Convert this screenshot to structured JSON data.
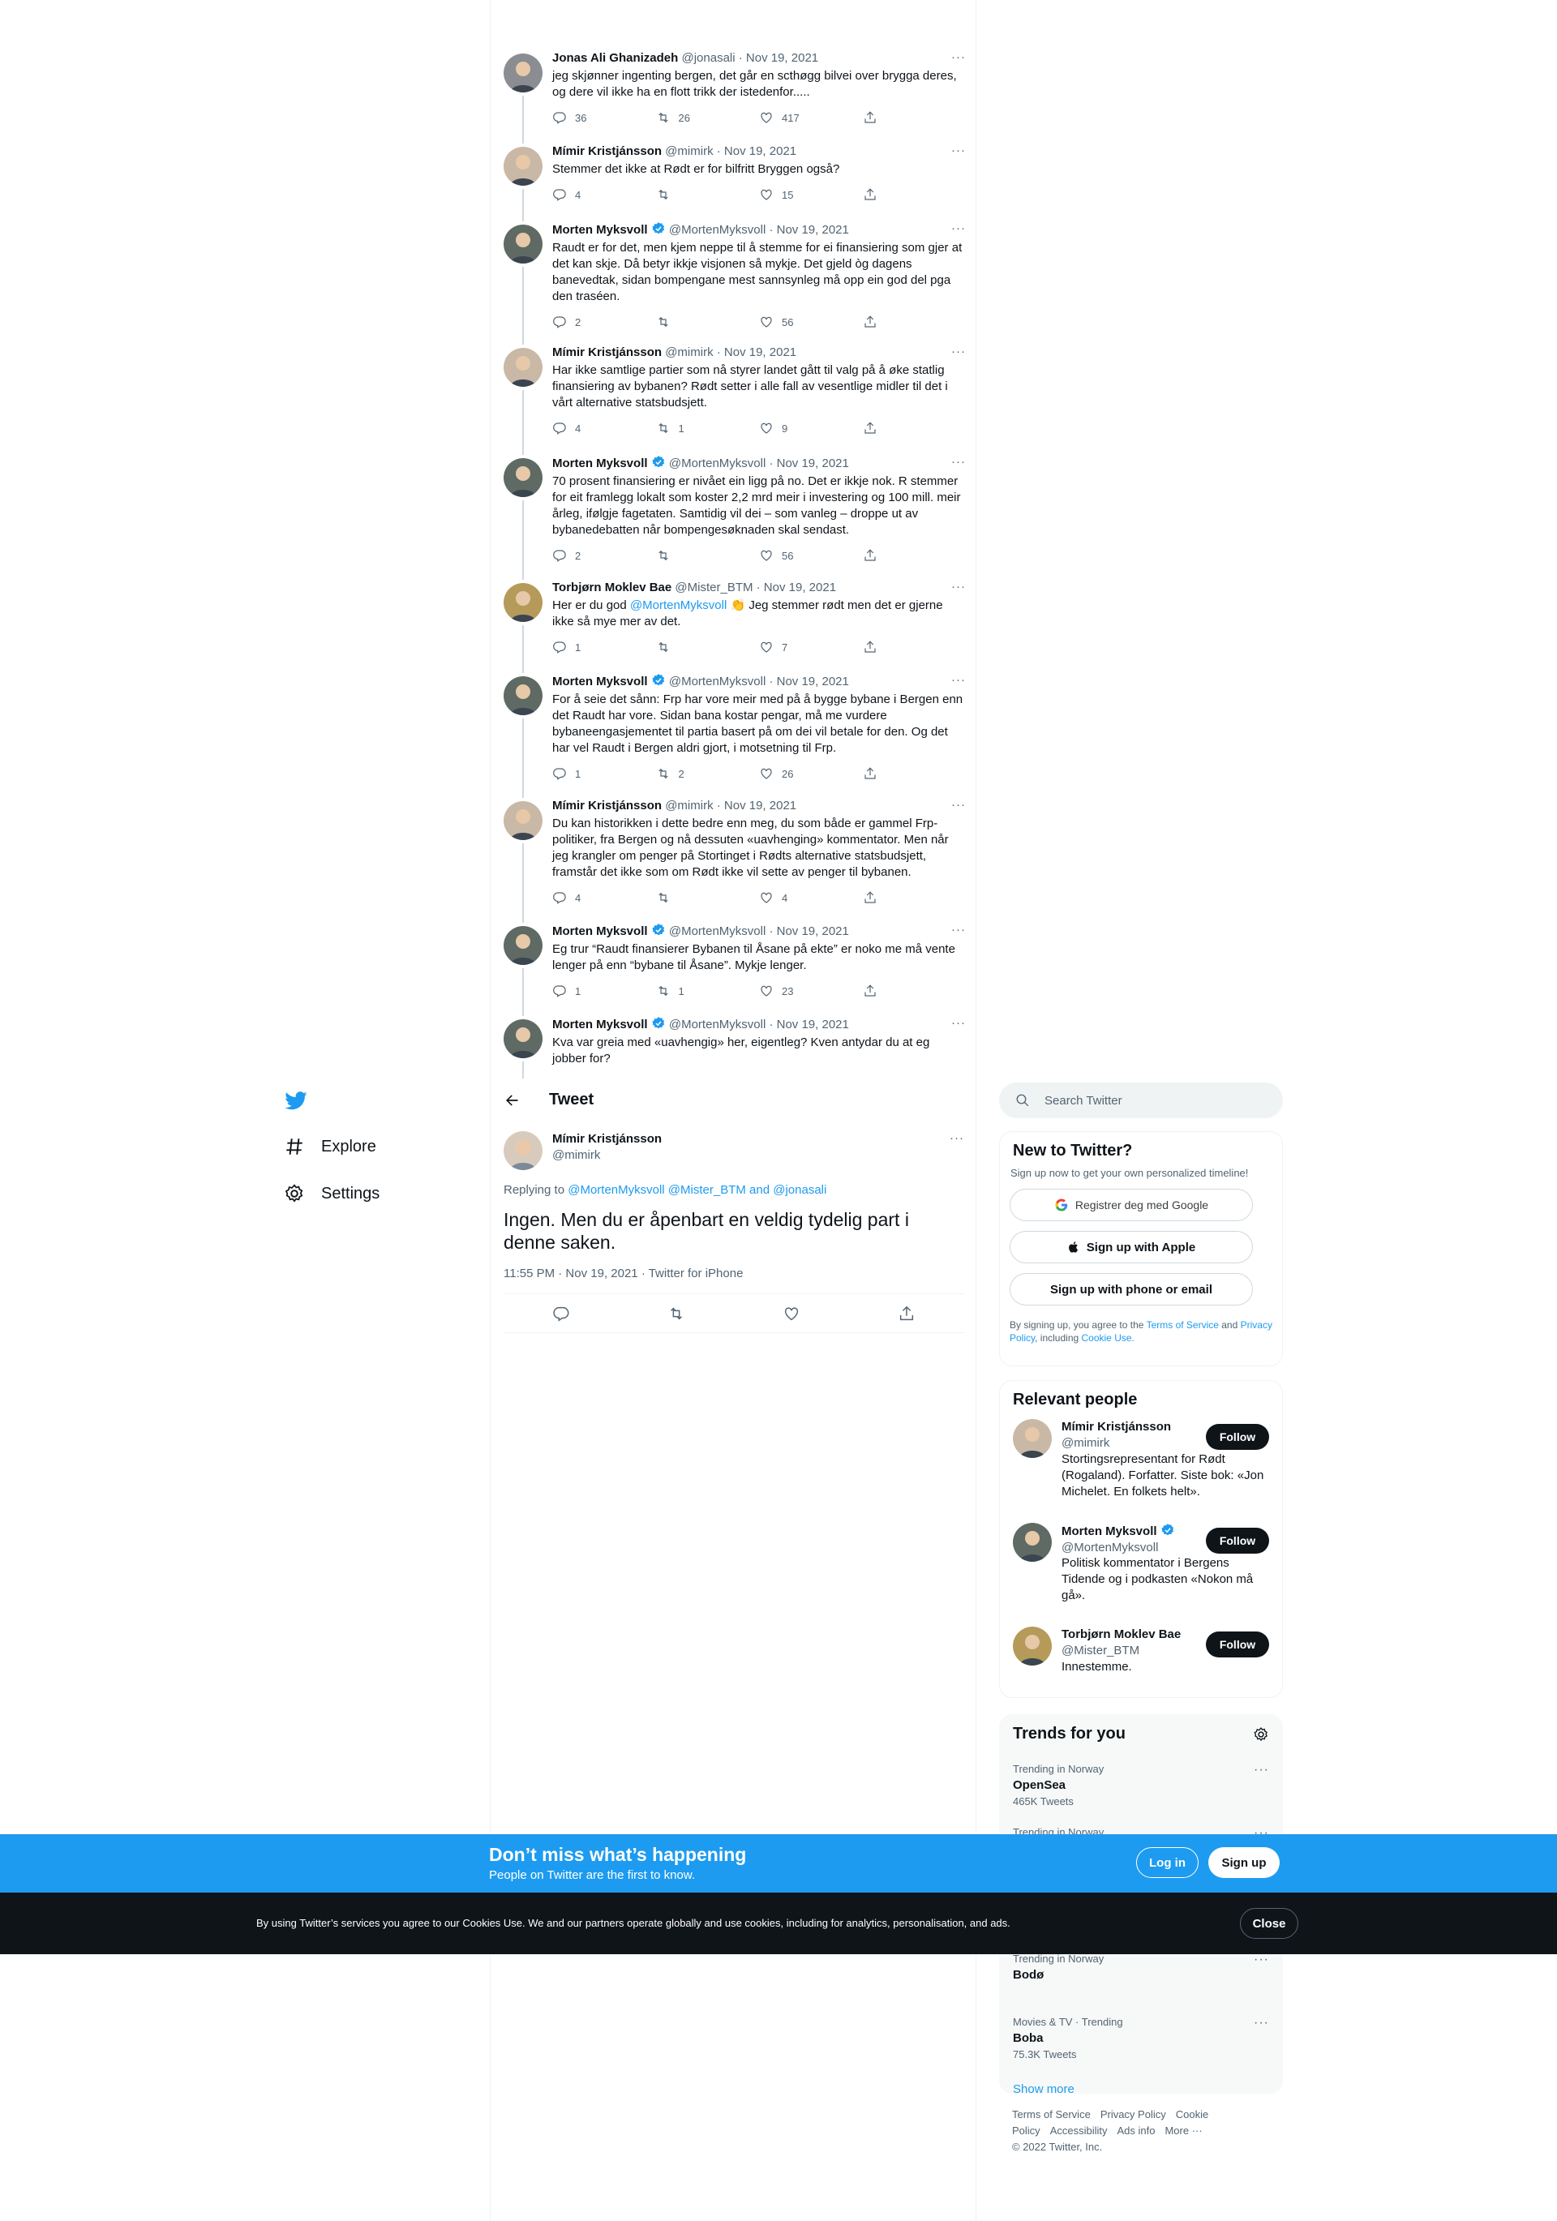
{
  "thread": [
    {
      "name": "Jonas Ali Ghanizadeh",
      "handle": "@jonasali",
      "date": "Nov 19, 2021",
      "verified": false,
      "text": "jeg skjønner ingenting bergen, det går en scthøgg bilvei over brygga deres, og dere vil ikke ha en flott trikk der istedenfor.....",
      "replies": "36",
      "retweets": "26",
      "likes": "417",
      "avatar": "#8a8d92"
    },
    {
      "name": "Mímir Kristjánsson",
      "handle": "@mimirk",
      "date": "Nov 19, 2021",
      "verified": false,
      "text": "Stemmer det ikke at Rødt er for bilfritt Bryggen også?",
      "replies": "4",
      "retweets": "",
      "likes": "15",
      "avatar": "#c9b8a6"
    },
    {
      "name": "Morten Myksvoll",
      "handle": "@MortenMyksvoll",
      "date": "Nov 19, 2021",
      "verified": true,
      "text": "Raudt er for det, men kjem neppe til å stemme for ei finansiering som gjer at det kan skje. Då betyr ikkje visjonen så mykje. Det gjeld òg dagens banevedtak, sidan bompengane mest sannsynleg må opp ein god del pga den traséen.",
      "replies": "2",
      "retweets": "",
      "likes": "56",
      "avatar": "#5e6a63"
    },
    {
      "name": "Mímir Kristjánsson",
      "handle": "@mimirk",
      "date": "Nov 19, 2021",
      "verified": false,
      "text": "Har ikke samtlige partier som nå styrer landet gått til valg på å øke statlig finansiering av bybanen? Rødt setter i alle fall av vesentlige midler til det i vårt alternative statsbudsjett.",
      "replies": "4",
      "retweets": "1",
      "likes": "9",
      "avatar": "#c9b8a6"
    },
    {
      "name": "Morten Myksvoll",
      "handle": "@MortenMyksvoll",
      "date": "Nov 19, 2021",
      "verified": true,
      "text": "70 prosent finansiering er nivået ein ligg på no. Det er ikkje nok. R stemmer for eit framlegg lokalt som koster 2,2 mrd meir i investering og 100 mill. meir årleg, ifølgje fagetaten. Samtidig vil dei – som vanleg – droppe ut av bybanedebatten når bompengesøknaden skal sendast.",
      "replies": "2",
      "retweets": "",
      "likes": "56",
      "avatar": "#5e6a63"
    },
    {
      "name": "Torbjørn Moklev Bae",
      "handle": "@Mister_BTM",
      "date": "Nov 19, 2021",
      "verified": false,
      "text_before": "Her er du god ",
      "mention": "@MortenMyksvoll",
      "text_after": " 👏 Jeg stemmer rødt men det er gjerne ikke så mye mer av det.",
      "replies": "1",
      "retweets": "",
      "likes": "7",
      "avatar": "#b59a5a"
    },
    {
      "name": "Morten Myksvoll",
      "handle": "@MortenMyksvoll",
      "date": "Nov 19, 2021",
      "verified": true,
      "text": "For å seie det sånn: Frp har vore meir med på å bygge bybane i Bergen enn det Raudt har vore. Sidan bana kostar pengar, må me vurdere bybaneengasjementet til partia basert på om dei vil betale for den. Og det har vel Raudt i Bergen aldri gjort, i motsetning til Frp.",
      "replies": "1",
      "retweets": "2",
      "likes": "26",
      "avatar": "#5e6a63"
    },
    {
      "name": "Mímir Kristjánsson",
      "handle": "@mimirk",
      "date": "Nov 19, 2021",
      "verified": false,
      "text": "Du kan historikken i dette bedre enn meg, du som både er gammel Frp-politiker, fra Bergen og nå dessuten «uavhenging» kommentator. Men når jeg krangler om penger på Stortinget i Rødts alternative statsbudsjett, framstår det ikke som om Rødt ikke vil sette av penger til bybanen.",
      "replies": "4",
      "retweets": "",
      "likes": "4",
      "avatar": "#c9b8a6"
    },
    {
      "name": "Morten Myksvoll",
      "handle": "@MortenMyksvoll",
      "date": "Nov 19, 2021",
      "verified": true,
      "text": "Eg trur “Raudt finansierer Bybanen til Åsane på ekte” er noko me må vente lenger på enn “bybane til Åsane”. Mykje lenger.",
      "replies": "1",
      "retweets": "1",
      "likes": "23",
      "avatar": "#5e6a63"
    },
    {
      "name": "Morten Myksvoll",
      "handle": "@MortenMyksvoll",
      "date": "Nov 19, 2021",
      "verified": true,
      "text": "Kva var greia med «uavhengig» her, eigentleg? Kven antydar du at eg jobber for?",
      "replies": "",
      "retweets": "",
      "likes": "",
      "avatar": "#5e6a63"
    }
  ],
  "header": {
    "title": "Tweet"
  },
  "nav": {
    "explore": "Explore",
    "settings": "Settings"
  },
  "focus": {
    "name": "Mímir Kristjánsson",
    "handle": "@mimirk",
    "replying_label": "Replying to",
    "replying_to": "@MortenMyksvoll @Mister_BTM and @jonasali",
    "text": "Ingen. Men du er åpenbart en veldig tydelig part i denne saken.",
    "meta": "11:55 PM · Nov 19, 2021 · Twitter for iPhone"
  },
  "search": {
    "placeholder": "Search Twitter"
  },
  "new_to_twitter": {
    "title": "New to Twitter?",
    "subtitle": "Sign up now to get your own personalized timeline!",
    "google": "Registrer deg med Google",
    "apple": "Sign up with Apple",
    "phone": "Sign up with phone or email",
    "terms_1": "By signing up, you agree to the ",
    "terms_link1": "Terms of Service",
    "terms_2": " and ",
    "terms_link2": "Privacy Policy",
    "terms_3": ", including ",
    "terms_link3": "Cookie Use."
  },
  "relevant": {
    "title": "Relevant people",
    "follow_label": "Follow",
    "people": [
      {
        "name": "Mímir Kristjánsson",
        "handle": "@mimirk",
        "bio": "Stortingsrepresentant for Rødt (Rogaland). Forfatter. Siste bok: «Jon Michelet. En folkets helt».",
        "avatar": "#c9b8a6"
      },
      {
        "name": "Morten Myksvoll",
        "handle": "@MortenMyksvoll",
        "bio": "Politisk kommentator i Bergens Tidende og i podkasten «Nokon må gå».",
        "avatar": "#5e6a63"
      },
      {
        "name": "Torbjørn Moklev Bae",
        "handle": "@Mister_BTM",
        "bio": "Innestemme.",
        "avatar": "#b59a5a"
      }
    ]
  },
  "trends": {
    "title": "Trends for you",
    "items": [
      {
        "category": "Trending in Norway",
        "name": "OpenSea",
        "count": "465K Tweets"
      },
      {
        "category": "Trending in Norway",
        "name": "",
        "count": ""
      },
      {
        "category": "",
        "name": "",
        "count": ""
      },
      {
        "category": "Trending in Norway",
        "name": "Bodø",
        "count": ""
      },
      {
        "category": "Movies & TV · Trending",
        "name": "Boba",
        "count": "75.3K Tweets"
      }
    ],
    "show_more": "Show more"
  },
  "footer": {
    "links": [
      "Terms of Service",
      "Privacy Policy",
      "Cookie Policy",
      "Accessibility",
      "Ads info",
      "More ···"
    ],
    "copyright": "© 2022 Twitter, Inc."
  },
  "banner": {
    "title": "Don’t miss what’s happening",
    "subtitle": "People on Twitter are the first to know.",
    "login": "Log in",
    "signup": "Sign up"
  },
  "cookie": {
    "text": "By using Twitter’s services you agree to our Cookies Use. We and our partners operate globally and use cookies, including for analytics, personalisation, and ads.",
    "close": "Close"
  },
  "colors": {
    "accent": "#1d9bf0",
    "text": "#0f1419",
    "muted": "#536471",
    "border": "#eff3f4"
  }
}
